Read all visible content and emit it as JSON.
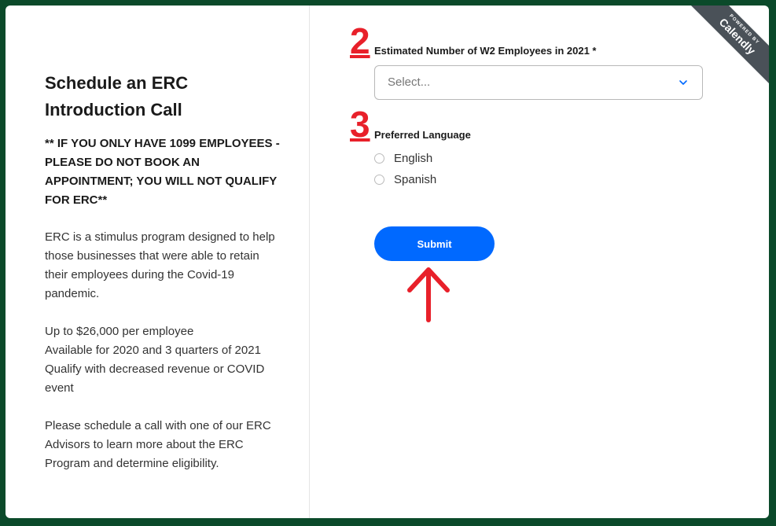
{
  "event": {
    "title": "Schedule an ERC Introduction Call",
    "warning": "** IF YOU ONLY HAVE 1099 EMPLOYEES - PLEASE DO NOT BOOK AN APPOINTMENT; YOU WILL NOT QUALIFY FOR ERC**",
    "description_1": "ERC is a stimulus program designed to help those businesses that were able to retain their employees during the Covid-19 pandemic.",
    "description_2_lines": [
      "Up to $26,000 per employee",
      "Available for 2020 and 3 quarters of 2021",
      "Qualify with decreased revenue or COVID event"
    ],
    "description_3": "Please schedule a call with one of our ERC Advisors to learn more about the ERC Program and determine eligibility."
  },
  "annotations": {
    "step_2": "2",
    "step_3": "3",
    "arrow_color": "#e8202a"
  },
  "form": {
    "employees_label": "Estimated Number of W2 Employees in 2021 *",
    "employees_placeholder": "Select...",
    "language_label": "Preferred Language",
    "language_options": [
      "English",
      "Spanish"
    ],
    "submit_label": "Submit"
  },
  "badge": {
    "small_text": "POWERED BY",
    "brand": "Calendly"
  },
  "colors": {
    "accent": "#0069ff",
    "background": "#0b4a2a",
    "badge": "#4a5158"
  }
}
